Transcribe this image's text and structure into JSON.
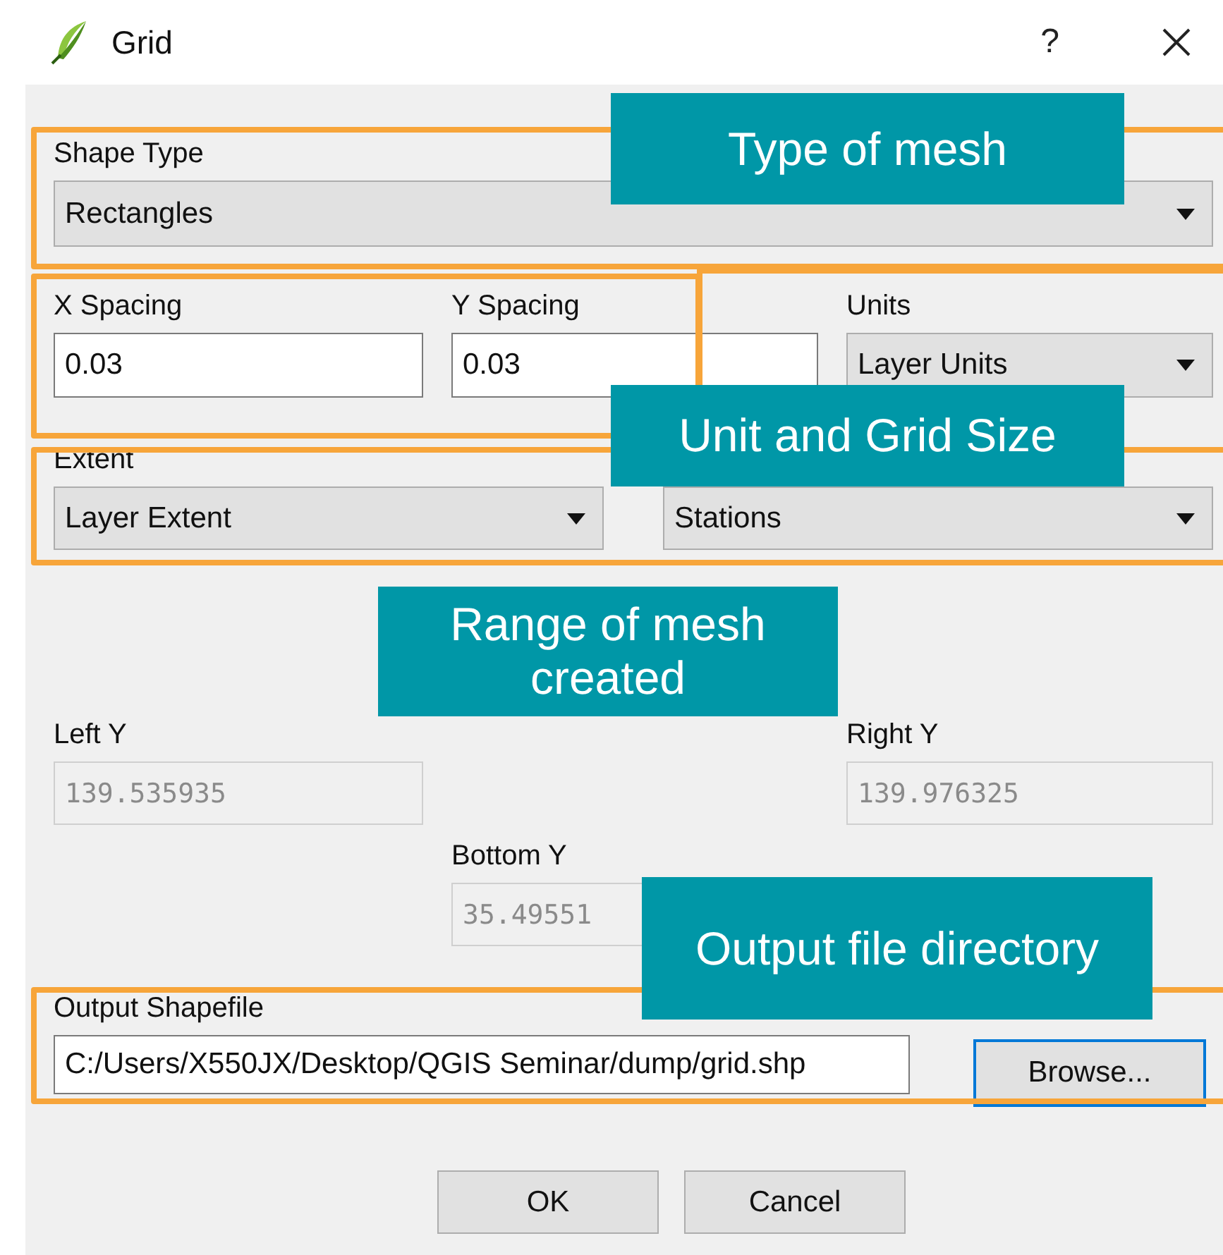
{
  "window": {
    "title": "Grid",
    "help": "?"
  },
  "shape_type": {
    "label": "Shape Type",
    "value": "Rectangles"
  },
  "x_spacing": {
    "label": "X Spacing",
    "value": "0.03"
  },
  "y_spacing": {
    "label": "Y Spacing",
    "value": "0.03"
  },
  "units": {
    "label": "Units",
    "value": "Layer Units"
  },
  "extent": {
    "label": "Extent",
    "value": "Layer Extent"
  },
  "extent_layer": {
    "value": "Stations"
  },
  "left_y": {
    "label": "Left Y",
    "value": "139.535935",
    "disabled": true
  },
  "right_y": {
    "label": "Right Y",
    "value": "139.976325",
    "disabled": true
  },
  "bottom_y": {
    "label": "Bottom Y",
    "value": "35.49551",
    "disabled": true
  },
  "output": {
    "label": "Output Shapefile",
    "value": "C:/Users/X550JX/Desktop/QGIS Seminar/dump/grid.shp",
    "button": "Browse...",
    "button_focused": true
  },
  "buttons": [
    "OK",
    "Cancel"
  ],
  "annotations": [
    {
      "text": "Type of mesh"
    },
    {
      "text": "Unit and Grid Size"
    },
    {
      "text": "Range of mesh created"
    },
    {
      "text": "Output file directory"
    }
  ]
}
